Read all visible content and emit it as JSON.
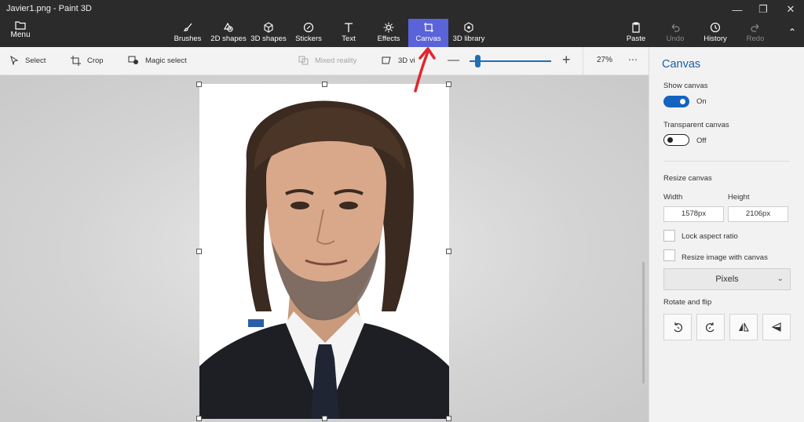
{
  "app": {
    "title": "Javier1.png - Paint 3D",
    "menu_label": "Menu"
  },
  "ribbon": {
    "tools": [
      {
        "label": "Brushes",
        "icon": "brush-icon"
      },
      {
        "label": "2D shapes",
        "icon": "2d-shapes-icon"
      },
      {
        "label": "3D shapes",
        "icon": "3d-shapes-icon"
      },
      {
        "label": "Stickers",
        "icon": "stickers-icon"
      },
      {
        "label": "Text",
        "icon": "text-icon"
      },
      {
        "label": "Effects",
        "icon": "effects-icon"
      },
      {
        "label": "Canvas",
        "icon": "canvas-icon",
        "active": true
      },
      {
        "label": "3D library",
        "icon": "3d-library-icon"
      }
    ],
    "right_tools": [
      {
        "label": "Paste",
        "icon": "paste-icon"
      },
      {
        "label": "Undo",
        "icon": "undo-icon",
        "disabled": true
      },
      {
        "label": "History",
        "icon": "history-icon"
      },
      {
        "label": "Redo",
        "icon": "redo-icon",
        "disabled": true
      }
    ],
    "accent_color": "#5b63d9"
  },
  "subtoolbar": {
    "select_label": "Select",
    "crop_label": "Crop",
    "magic_select_label": "Magic select",
    "mixed_reality_label": "Mixed reality",
    "view3d_label": "3D vi",
    "zoom_value": "27%",
    "zoom_level": 0.1
  },
  "panel": {
    "title": "Canvas",
    "show_canvas_label": "Show canvas",
    "show_canvas_state": "On",
    "transparent_canvas_label": "Transparent canvas",
    "transparent_canvas_state": "Off",
    "resize_label": "Resize canvas",
    "width_label": "Width",
    "height_label": "Height",
    "width_value": "1578px",
    "height_value": "2106px",
    "lock_aspect_label": "Lock aspect ratio",
    "resize_image_label": "Resize image with canvas",
    "units_value": "Pixels",
    "rotate_flip_label": "Rotate and flip",
    "title_color": "#1c5fa8",
    "toggle_color": "#1463c0"
  }
}
